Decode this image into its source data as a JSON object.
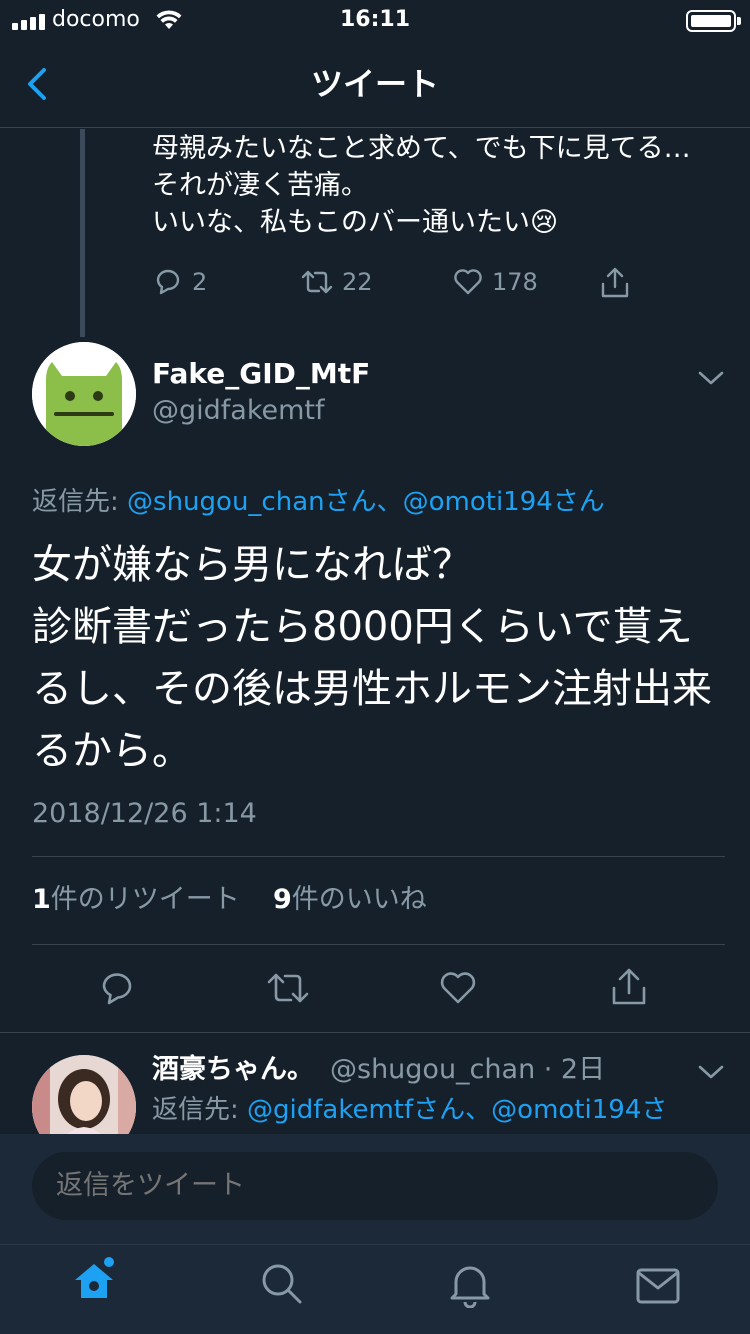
{
  "status_bar": {
    "carrier": "docomo",
    "time": "16:11"
  },
  "nav": {
    "title": "ツイート",
    "back_icon": "chevron-left-icon"
  },
  "previous_tweet": {
    "text": "母親みたいなこと求めて、でも下に見てる…\nそれが凄く苦痛。\nいいな、私もこのバー通いたい😢",
    "replies": "2",
    "retweets": "22",
    "likes": "178"
  },
  "main_tweet": {
    "display_name": "Fake_GID_MtF",
    "handle": "@gidfakemtf",
    "reply_prefix": "返信先: ",
    "reply_user_1": "@shugou_chanさん",
    "reply_sep": "、",
    "reply_user_2": "@omoti194さん",
    "text": "女が嫌なら男になれば？\n診断書だったら8000円くらいで貰えるし、その後は男性ホルモン注射出来るから。",
    "timestamp": "2018/12/26 1:14",
    "retweet_count": "1",
    "retweet_label": "件のリツイート",
    "like_count": "9",
    "like_label": "件のいいね"
  },
  "reply_tweet": {
    "display_name": "酒豪ちゃん。",
    "meta": "@shugou_chan · 2日",
    "reply_prefix": "返信先: ",
    "reply_user_1": "@gidfakemtfさん",
    "reply_sep": "、",
    "reply_user_2": "@omoti194さ"
  },
  "compose": {
    "placeholder": "返信をツイート"
  },
  "colors": {
    "background": "#15202b",
    "accent": "#1da1f2",
    "secondary_text": "#8899a6",
    "divider": "#38444d"
  },
  "tabs": [
    "home-icon",
    "search-icon",
    "notifications-icon",
    "messages-icon"
  ]
}
